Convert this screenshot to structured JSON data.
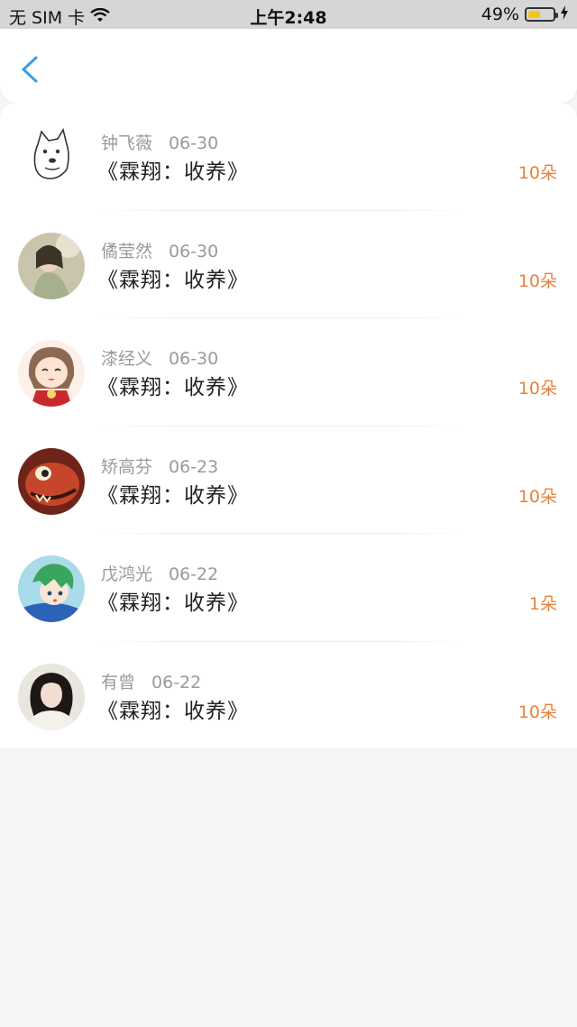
{
  "status_bar": {
    "carrier": "无 SIM 卡",
    "time": "上午2:48",
    "battery_percent": "49%",
    "battery_level": 0.49
  },
  "nav": {
    "back_icon": "chevron-left-icon",
    "accent": "#3a9ee6"
  },
  "colors": {
    "amount": "#e8823a",
    "meta": "#9a9a9a",
    "title": "#222222"
  },
  "records": [
    {
      "name": "钟飞薇",
      "date": "06-30",
      "title": "《霖翔：收养》",
      "amount": "10朵",
      "avatar": "doge-sketch"
    },
    {
      "name": "僪莹然",
      "date": "06-30",
      "title": "《霖翔：收养》",
      "amount": "10朵",
      "avatar": "painted-figure"
    },
    {
      "name": "漆经义",
      "date": "06-30",
      "title": "《霖翔：收养》",
      "amount": "10朵",
      "avatar": "anime-girl"
    },
    {
      "name": "矫高芬",
      "date": "06-23",
      "title": "《霖翔：收养》",
      "amount": "10朵",
      "avatar": "cartoon-creature"
    },
    {
      "name": "戊鸿光",
      "date": "06-22",
      "title": "《霖翔：收养》",
      "amount": "1朵",
      "avatar": "green-hair-anime"
    },
    {
      "name": "有曾",
      "date": "06-22",
      "title": "《霖翔：收养》",
      "amount": "10朵",
      "avatar": "woman-photo"
    }
  ]
}
